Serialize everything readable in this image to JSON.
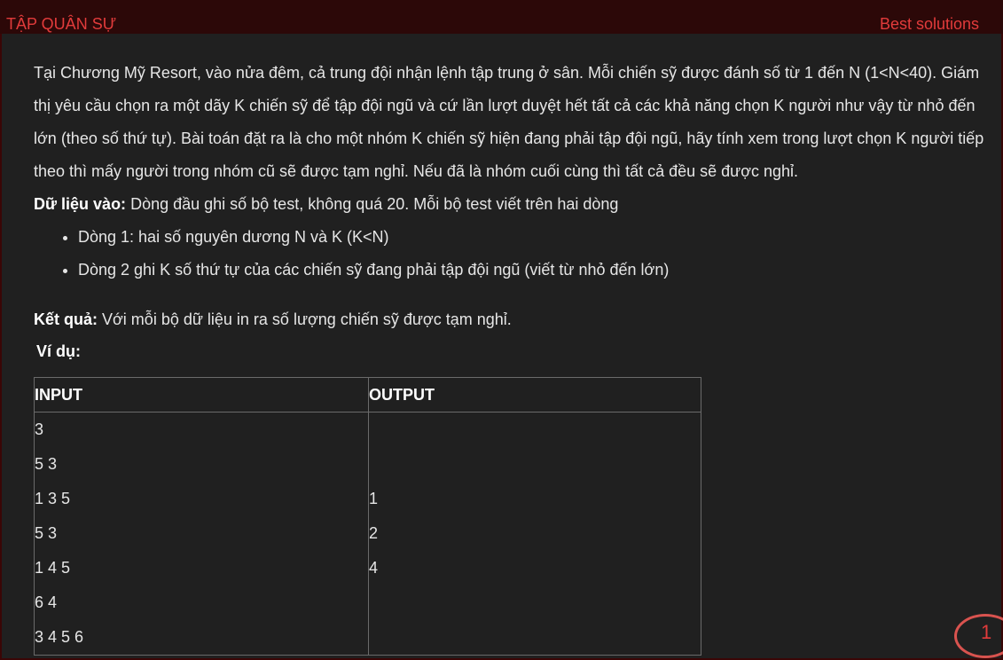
{
  "header": {
    "title": "TẬP QUÂN SỰ",
    "link": "Best solutions"
  },
  "problem": {
    "paragraph": "Tại Chương Mỹ Resort, vào nửa đêm, cả trung đội nhận lệnh tập trung ở sân. Mỗi chiến sỹ được đánh số từ 1 đến N (1<N<40). Giám thị yêu cầu chọn ra một dãy K chiến sỹ để tập đội ngũ và cứ lần lượt duyệt hết tất cả các khả năng chọn K người như vậy từ nhỏ đến lớn (theo số thứ tự). Bài toán đặt ra là cho một nhóm K chiến sỹ hiện đang phải tập đội ngũ, hãy tính xem trong lượt chọn K người tiếp theo thì mấy người trong nhóm cũ sẽ được tạm nghỉ. Nếu đã là nhóm cuối cùng thì tất cả đều sẽ được nghỉ.",
    "input_label": "Dữ liệu vào:",
    "input_text": " Dòng đầu ghi số bộ test, không quá 20. Mỗi bộ test viết trên hai dòng",
    "bullets": [
      "Dòng 1: hai số nguyên dương N và K (K<N)",
      "Dòng 2 ghi K số thứ tự của các chiến sỹ đang phải tập đội ngũ (viết từ nhỏ đến lớn)"
    ],
    "output_label": "Kết quả:",
    "output_text": " Với mỗi bộ dữ liệu in ra số lượng chiến sỹ được tạm nghỉ.",
    "example_label": "Ví dụ:"
  },
  "example_table": {
    "headers": [
      "INPUT",
      "OUTPUT"
    ],
    "input_lines": [
      "3",
      "5 3",
      "1 3 5",
      "5 3",
      "1 4 5",
      "6 4",
      "3 4 5 6"
    ],
    "output_lines": [
      "",
      "",
      "1",
      "2",
      "4",
      "",
      ""
    ]
  },
  "badge": {
    "count": "1"
  }
}
